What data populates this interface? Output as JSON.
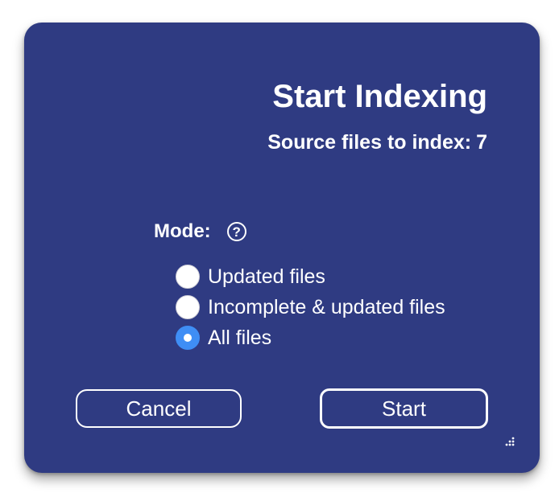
{
  "dialog": {
    "title": "Start Indexing",
    "source_files_label": "Source files to index:",
    "source_files_count": "7"
  },
  "mode": {
    "label": "Mode:",
    "help_icon_glyph": "?",
    "options": [
      {
        "label": "Updated files",
        "selected": false
      },
      {
        "label": "Incomplete & updated files",
        "selected": false
      },
      {
        "label": "All files",
        "selected": true
      }
    ]
  },
  "buttons": {
    "cancel_label": "Cancel",
    "start_label": "Start"
  },
  "colors": {
    "dialog_background": "#2f3b82",
    "radio_selected": "#3f8ef5",
    "text": "#ffffff"
  },
  "icons": {
    "help": "question-circle-icon",
    "resize": "resize-grip-icon"
  }
}
